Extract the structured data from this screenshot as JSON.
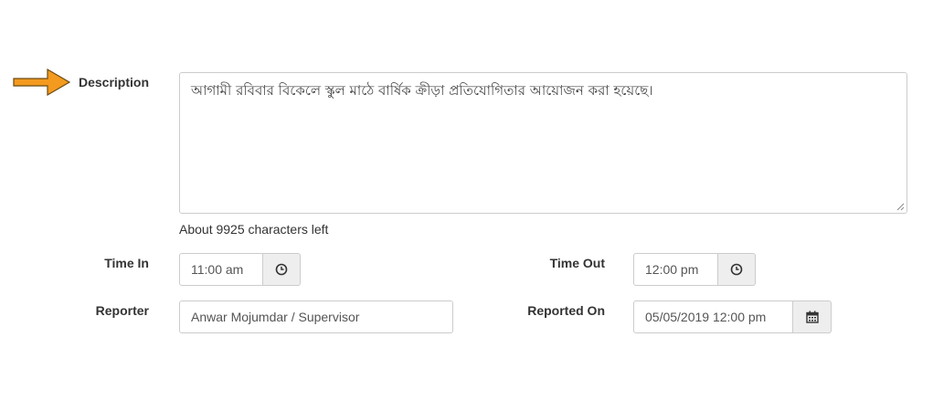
{
  "description": {
    "label": "Description",
    "value": "আগামী রবিবার বিকেলে স্কুল মাঠে বার্ষিক ক্রীড়া প্রতিযোগিতার আয়োজন করা হয়েছে।",
    "help_text": "About 9925 characters left"
  },
  "time_in": {
    "label": "Time In",
    "value": "11:00 am",
    "icon": "clock-icon"
  },
  "time_out": {
    "label": "Time Out",
    "value": "12:00 pm",
    "icon": "clock-icon"
  },
  "reporter": {
    "label": "Reporter",
    "value": "Anwar Mojumdar / Supervisor"
  },
  "reported_on": {
    "label": "Reported On",
    "value": "05/05/2019 12:00 pm",
    "icon": "calendar-icon"
  },
  "colors": {
    "arrow": "#f39a1f",
    "addon_bg": "#eeeeee",
    "border": "#cccccc"
  }
}
